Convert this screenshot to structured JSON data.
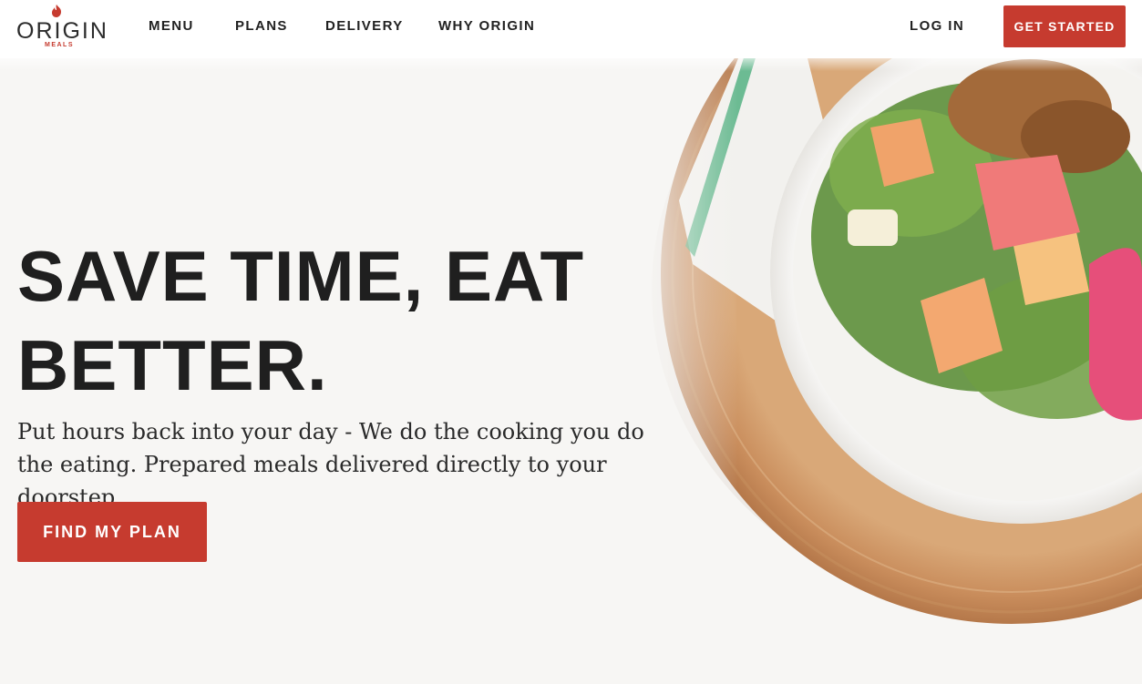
{
  "header": {
    "logo": {
      "name": "ORIGIN",
      "sub": "MEALS",
      "icon": "flame-icon",
      "brand_color": "#c63b2f"
    },
    "nav": [
      {
        "label": "MENU"
      },
      {
        "label": "PLANS"
      },
      {
        "label": "DELIVERY"
      },
      {
        "label": "WHY ORIGIN"
      }
    ],
    "login_label": "LOG IN",
    "cta_label": "GET STARTED"
  },
  "hero": {
    "headline": "SAVE TIME, EAT BETTER.",
    "subcopy": "Put hours back into your day - We do the cooking you do the eating. Prepared meals delivered directly to your doorstep.",
    "cta_label": "FIND MY PLAN",
    "image": "salad-bowl-on-wooden-board",
    "accent_color": "#c63b2f"
  }
}
